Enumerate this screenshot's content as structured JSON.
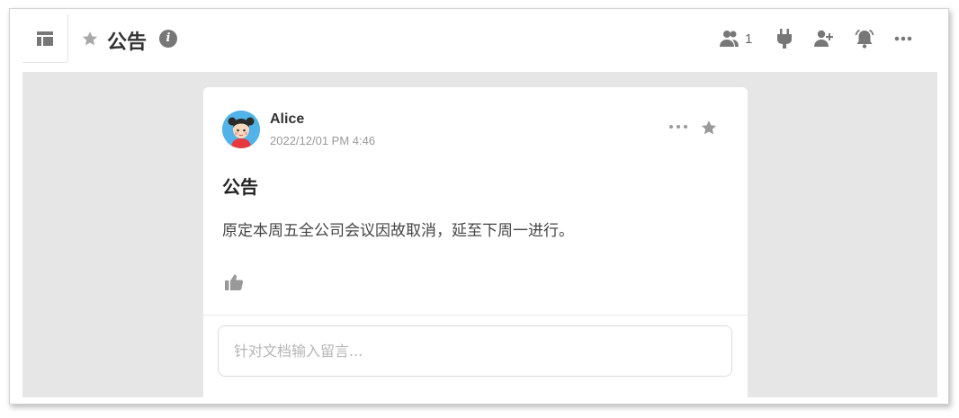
{
  "header": {
    "title": "公告",
    "member_count": "1"
  },
  "post": {
    "author": "Alice",
    "time": "2022/12/01 PM 4:46",
    "title": "公告",
    "body": "原定本周五全公司会议因故取消，延至下周一进行。"
  },
  "comment": {
    "placeholder": "针对文档输入留言..."
  },
  "icons": {
    "sidebar_toggle": "layout-panel-icon",
    "title_star": "star-icon",
    "info": "info-icon",
    "members": "users-icon",
    "integrations": "plug-icon",
    "add_member": "add-user-icon",
    "notifications": "bell-icon",
    "more": "more-icon",
    "post_more": "more-icon",
    "post_star": "star-icon",
    "like": "thumbs-up-icon"
  },
  "colors": {
    "content_bg": "#e6e6e6",
    "icon_gray": "#777777",
    "avatar_bg": "#52b3e8"
  }
}
